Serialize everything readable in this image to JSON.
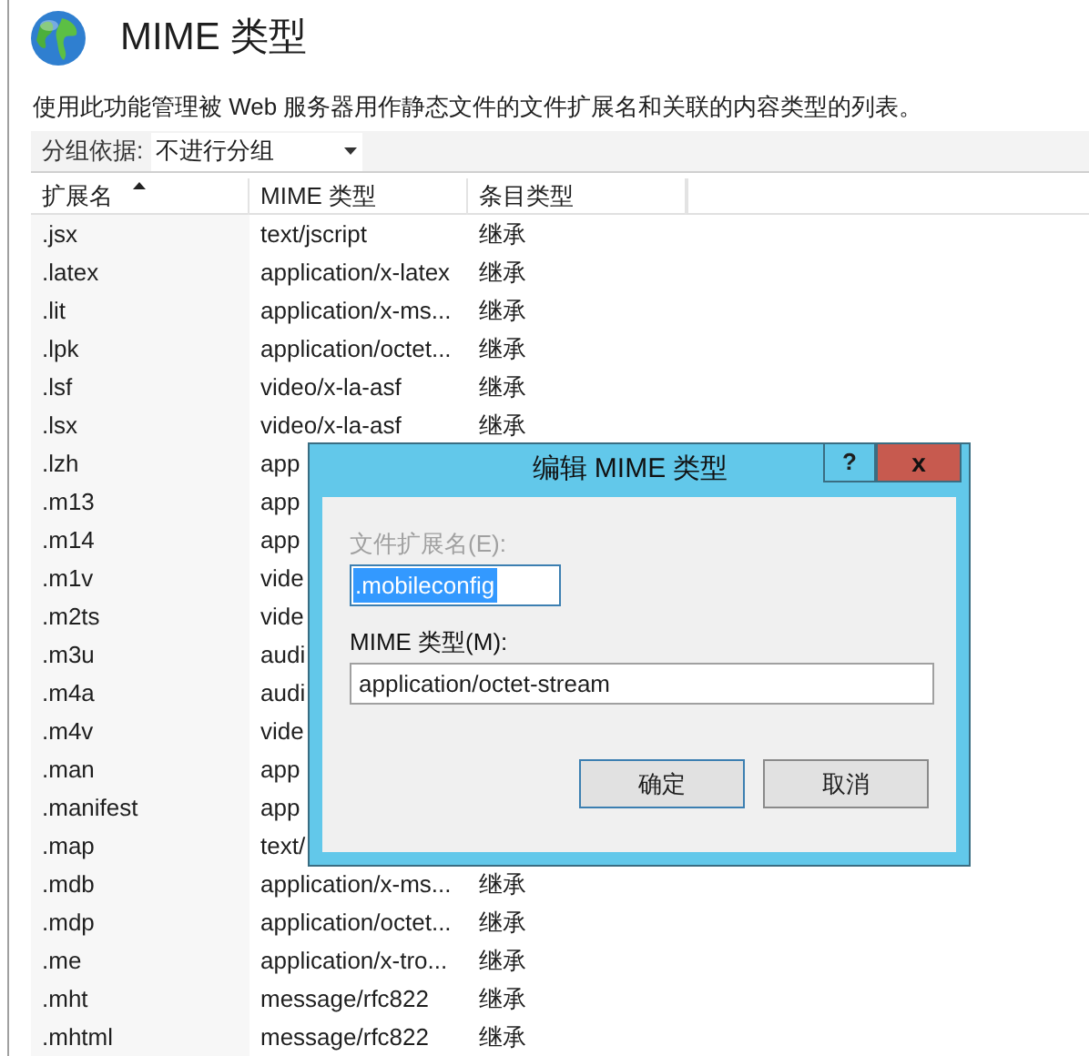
{
  "header": {
    "title": "MIME 类型",
    "description": "使用此功能管理被 Web 服务器用作静态文件的文件扩展名和关联的内容类型的列表。"
  },
  "group_by": {
    "label": "分组依据:",
    "value": "不进行分组"
  },
  "table": {
    "columns": [
      {
        "label": "扩展名",
        "sorted": true
      },
      {
        "label": "MIME 类型",
        "sorted": false
      },
      {
        "label": "条目类型",
        "sorted": false
      }
    ],
    "rows": [
      {
        "ext": ".jsx",
        "mime": "text/jscript",
        "type": "继承"
      },
      {
        "ext": ".latex",
        "mime": "application/x-latex",
        "type": "继承"
      },
      {
        "ext": ".lit",
        "mime": "application/x-ms...",
        "type": "继承"
      },
      {
        "ext": ".lpk",
        "mime": "application/octet...",
        "type": "继承"
      },
      {
        "ext": ".lsf",
        "mime": "video/x-la-asf",
        "type": "继承"
      },
      {
        "ext": ".lsx",
        "mime": "video/x-la-asf",
        "type": "继承"
      },
      {
        "ext": ".lzh",
        "mime": "app"
      },
      {
        "ext": ".m13",
        "mime": "app"
      },
      {
        "ext": ".m14",
        "mime": "app"
      },
      {
        "ext": ".m1v",
        "mime": "vide"
      },
      {
        "ext": ".m2ts",
        "mime": "vide"
      },
      {
        "ext": ".m3u",
        "mime": "audi"
      },
      {
        "ext": ".m4a",
        "mime": "audi"
      },
      {
        "ext": ".m4v",
        "mime": "vide"
      },
      {
        "ext": ".man",
        "mime": "app"
      },
      {
        "ext": ".manifest",
        "mime": "app"
      },
      {
        "ext": ".map",
        "mime": "text/"
      },
      {
        "ext": ".mdb",
        "mime": "application/x-ms...",
        "type": "继承"
      },
      {
        "ext": ".mdp",
        "mime": "application/octet...",
        "type": "继承"
      },
      {
        "ext": ".me",
        "mime": "application/x-tro...",
        "type": "继承"
      },
      {
        "ext": ".mht",
        "mime": "message/rfc822",
        "type": "继承"
      },
      {
        "ext": ".mhtml",
        "mime": "message/rfc822",
        "type": "继承"
      }
    ]
  },
  "dialog": {
    "title": "编辑 MIME 类型",
    "help_button": "?",
    "close_button": "x",
    "fields": [
      {
        "label": "文件扩展名(E):",
        "value": ".mobileconfig",
        "disabled": true,
        "text_selected": true
      },
      {
        "label": "MIME 类型(M):",
        "value": "application/octet-stream",
        "disabled": false,
        "text_selected": false
      }
    ],
    "buttons": [
      {
        "label": "确定",
        "default": true
      },
      {
        "label": "取消",
        "default": false
      }
    ]
  }
}
